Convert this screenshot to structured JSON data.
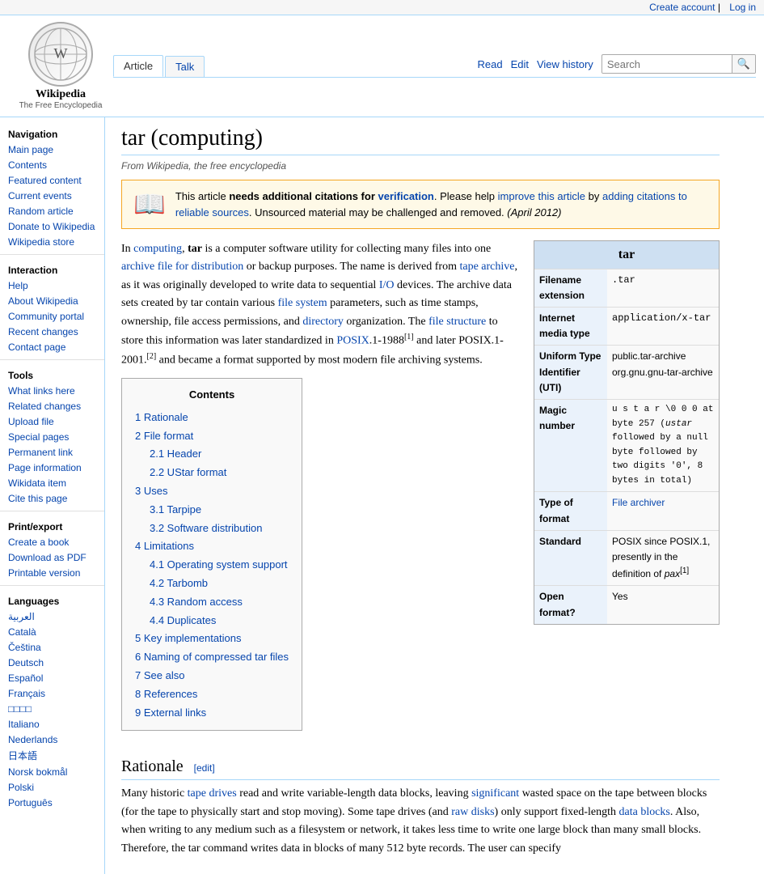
{
  "topbar": {
    "create_account": "Create account",
    "log_in": "Log in"
  },
  "logo": {
    "title": "Wikipedia",
    "subtitle": "The Free Encyclopedia",
    "icon": "🌐"
  },
  "tabs": {
    "article": "Article",
    "talk": "Talk",
    "read": "Read",
    "edit": "Edit",
    "view_history": "View history"
  },
  "search": {
    "placeholder": "Search",
    "button": "🔍"
  },
  "sidebar": {
    "navigation_title": "Navigation",
    "items_nav": [
      {
        "label": "Main page",
        "href": "#"
      },
      {
        "label": "Contents",
        "href": "#"
      },
      {
        "label": "Featured content",
        "href": "#"
      },
      {
        "label": "Current events",
        "href": "#"
      },
      {
        "label": "Random article",
        "href": "#"
      },
      {
        "label": "Donate to Wikipedia",
        "href": "#"
      },
      {
        "label": "Wikipedia store",
        "href": "#"
      }
    ],
    "interaction_title": "Interaction",
    "items_interaction": [
      {
        "label": "Help",
        "href": "#"
      },
      {
        "label": "About Wikipedia",
        "href": "#"
      },
      {
        "label": "Community portal",
        "href": "#"
      },
      {
        "label": "Recent changes",
        "href": "#"
      },
      {
        "label": "Contact page",
        "href": "#"
      }
    ],
    "tools_title": "Tools",
    "items_tools": [
      {
        "label": "What links here",
        "href": "#"
      },
      {
        "label": "Related changes",
        "href": "#"
      },
      {
        "label": "Upload file",
        "href": "#"
      },
      {
        "label": "Special pages",
        "href": "#"
      },
      {
        "label": "Permanent link",
        "href": "#"
      },
      {
        "label": "Page information",
        "href": "#"
      },
      {
        "label": "Wikidata item",
        "href": "#"
      },
      {
        "label": "Cite this page",
        "href": "#"
      }
    ],
    "print_title": "Print/export",
    "items_print": [
      {
        "label": "Create a book",
        "href": "#"
      },
      {
        "label": "Download as PDF",
        "href": "#"
      },
      {
        "label": "Printable version",
        "href": "#"
      }
    ],
    "languages_title": "Languages",
    "items_languages": [
      {
        "label": "العربية"
      },
      {
        "label": "Català"
      },
      {
        "label": "Čeština"
      },
      {
        "label": "Deutsch"
      },
      {
        "label": "Español"
      },
      {
        "label": "Français"
      },
      {
        "label": "□□□□"
      },
      {
        "label": "Italiano"
      },
      {
        "label": "Nederlands"
      },
      {
        "label": "日本語"
      },
      {
        "label": "Norsk bokmål"
      },
      {
        "label": "Polski"
      },
      {
        "label": "Português"
      }
    ]
  },
  "page": {
    "title": "tar (computing)",
    "from_line": "From Wikipedia, the free encyclopedia"
  },
  "citation_box": {
    "icon": "📖",
    "text_1": "This article ",
    "needs": "needs additional citations for ",
    "verification": "verification",
    "text_2": ". Please help ",
    "improve": "improve this article",
    "text_3": " by ",
    "adding": "adding citations to reliable sources",
    "text_4": ". Unsourced material may be challenged and removed. ",
    "date": "(April 2012)"
  },
  "infobox": {
    "title": "tar",
    "rows": [
      {
        "label": "Filename extension",
        "value": ".tar",
        "mono": true
      },
      {
        "label": "Internet media type",
        "value": "application/x-tar",
        "mono": true
      },
      {
        "label": "Uniform Type Identifier (UTI)",
        "value": "public.tar-archive org.gnu.gnu-tar-archive",
        "mono": false
      },
      {
        "label": "Magic number",
        "value": "ustar\\0 0 0 at byte 257 (ustar followed by a null byte followed by two digits '0', 8 bytes in total)",
        "mono": true
      },
      {
        "label": "Type of format",
        "value": "File archiver",
        "mono": false
      },
      {
        "label": "Standard",
        "value": "POSIX since POSIX.1, presently in the definition of pax[1]",
        "mono": false
      },
      {
        "label": "Open format?",
        "value": "Yes",
        "mono": false
      }
    ]
  },
  "article": {
    "intro": "In computing, tar is a computer software utility for collecting many files into one archive file for distribution or backup purposes. The name is derived from tape archive, as it was originally developed to write data to sequential I/O devices. The archive data sets created by tar contain various file system parameters, such as time stamps, ownership, file access permissions, and directory organization. The file structure to store this information was later standardized in POSIX.1-1988[1] and later POSIX.1-2001.[2] and became a format supported by most modern file archiving systems.",
    "toc_title": "Contents",
    "toc": [
      {
        "num": "1",
        "label": "Rationale",
        "sub": []
      },
      {
        "num": "2",
        "label": "File format",
        "sub": [
          {
            "num": "2.1",
            "label": "Header"
          },
          {
            "num": "2.2",
            "label": "UStar format"
          }
        ]
      },
      {
        "num": "3",
        "label": "Uses",
        "sub": [
          {
            "num": "3.1",
            "label": "Tarpipe"
          },
          {
            "num": "3.2",
            "label": "Software distribution"
          }
        ]
      },
      {
        "num": "4",
        "label": "Limitations",
        "sub": [
          {
            "num": "4.1",
            "label": "Operating system support"
          },
          {
            "num": "4.2",
            "label": "Tarbomb"
          },
          {
            "num": "4.3",
            "label": "Random access"
          },
          {
            "num": "4.4",
            "label": "Duplicates"
          }
        ]
      },
      {
        "num": "5",
        "label": "Key implementations",
        "sub": []
      },
      {
        "num": "6",
        "label": "Naming of compressed tar files",
        "sub": []
      },
      {
        "num": "7",
        "label": "See also",
        "sub": []
      },
      {
        "num": "8",
        "label": "References",
        "sub": []
      },
      {
        "num": "9",
        "label": "External links",
        "sub": []
      }
    ],
    "rationale_heading": "Rationale",
    "rationale_edit": "[edit]",
    "rationale_text": "Many historic tape drives read and write variable-length data blocks, leaving significant wasted space on the tape between blocks (for the tape to physically start and stop moving). Some tape drives (and raw disks) only support fixed-length data blocks. Also, when writing to any medium such as a filesystem or network, it takes less time to write one large block than many small blocks. Therefore, the tar command writes data in blocks of many 512 byte records. The user can specify"
  }
}
